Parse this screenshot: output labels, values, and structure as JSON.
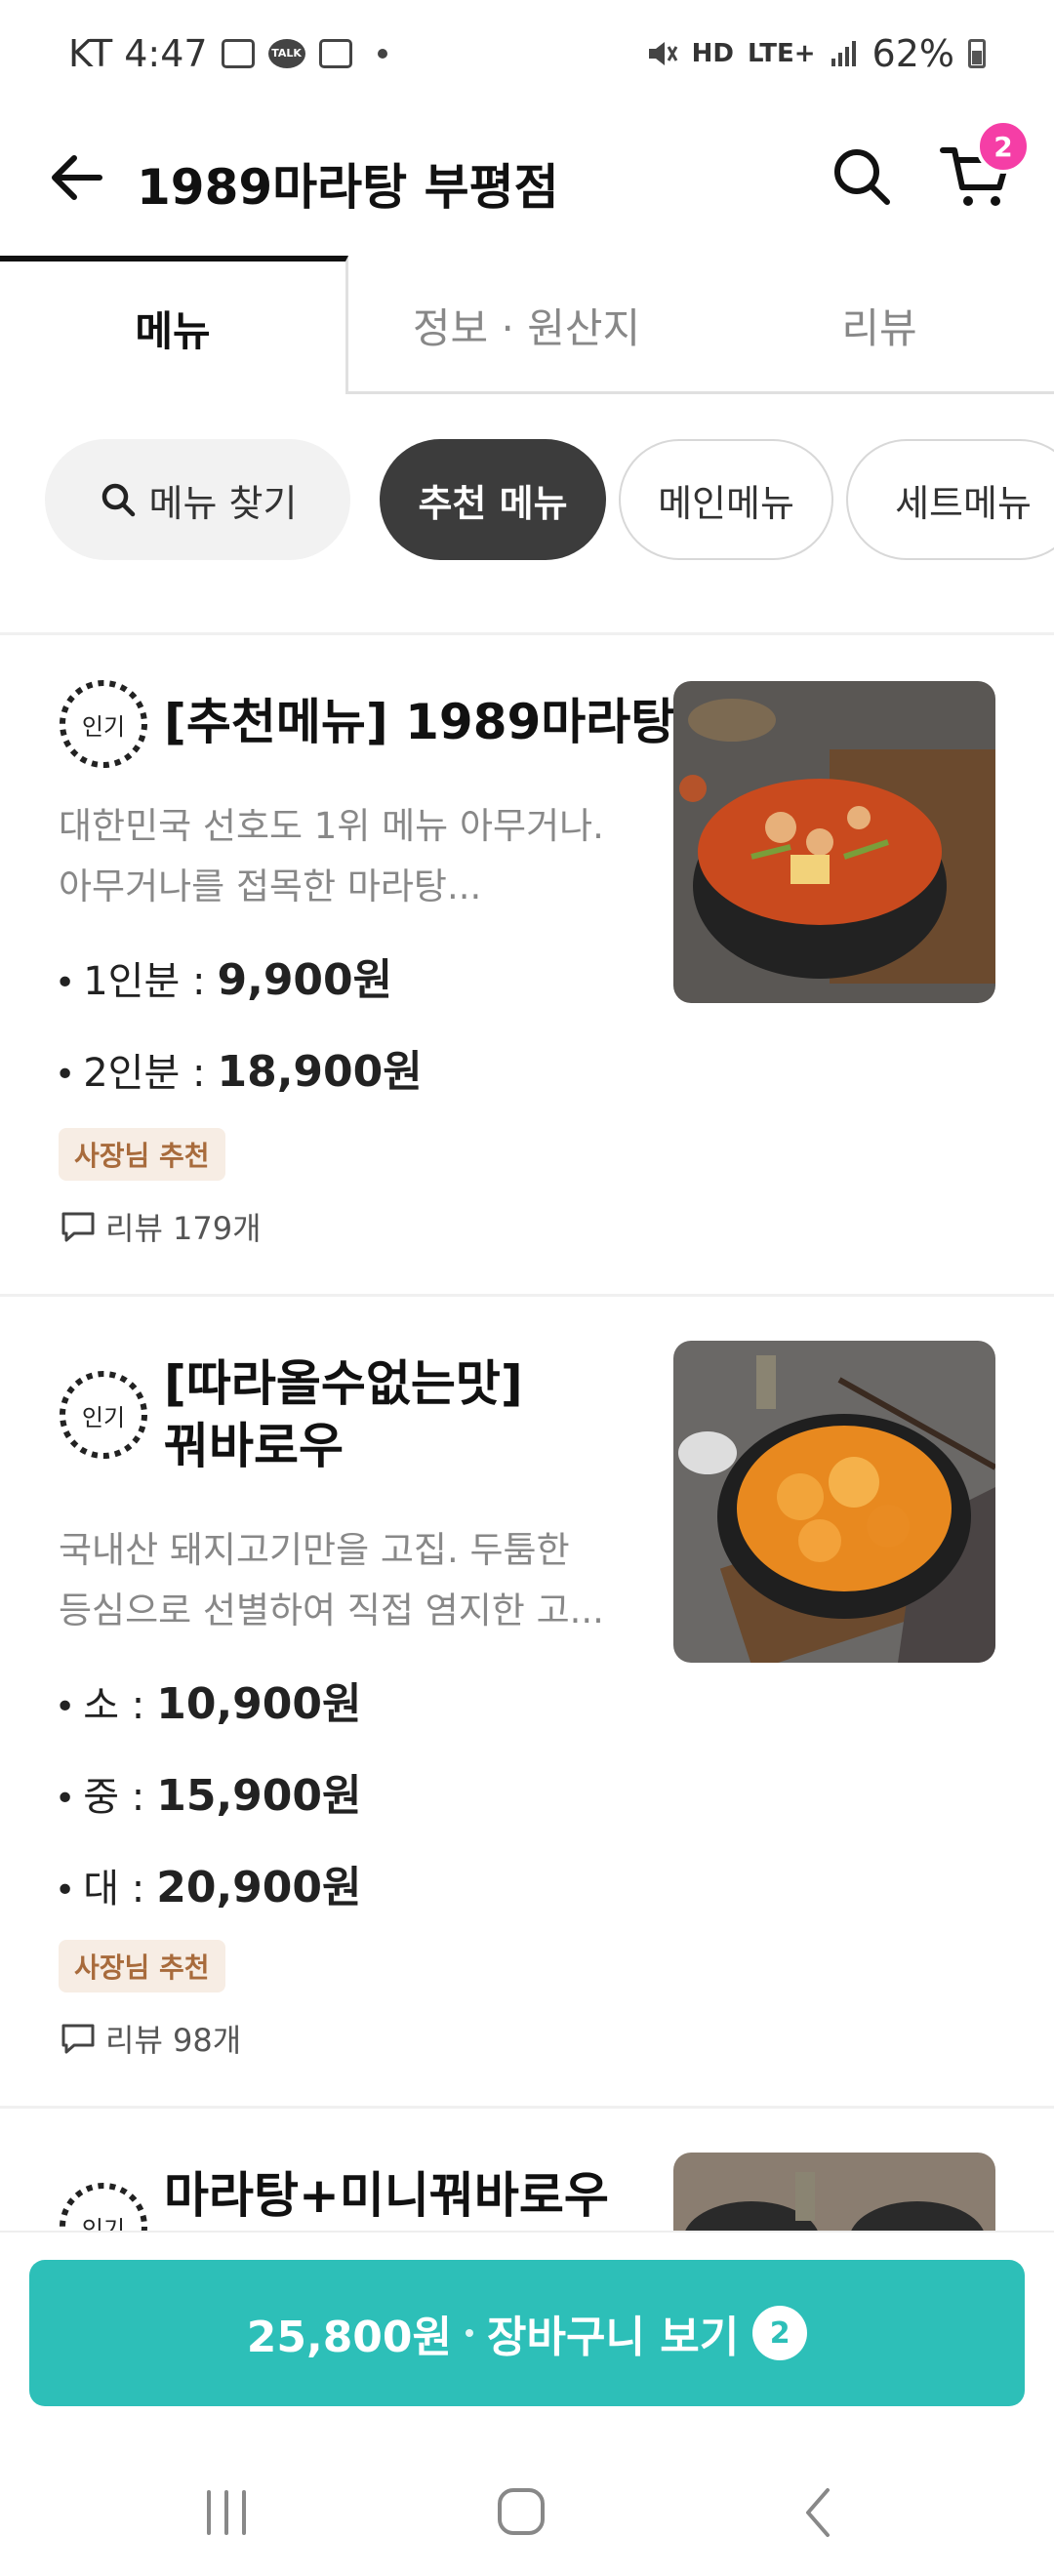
{
  "status_bar": {
    "carrier_time": "KT 4:47",
    "talk": "TALK",
    "hd": "HD",
    "network": "LTE+",
    "battery": "62%"
  },
  "header": {
    "title": "1989마라탕 부평점",
    "cart_count": "2"
  },
  "tabs": [
    {
      "label": "메뉴"
    },
    {
      "label": "정보 · 원산지"
    },
    {
      "label": "리뷰"
    }
  ],
  "filters": {
    "search_label": "메뉴 찾기",
    "chips": [
      {
        "label": "추천 메뉴"
      },
      {
        "label": "메인메뉴"
      },
      {
        "label": "세트메뉴"
      }
    ]
  },
  "menu_items": [
    {
      "badge": "인기",
      "name": "[추천메뉴] 1989마라탕",
      "desc_line1": "대한민국 선호도 1위 메뉴 아무거나.",
      "desc_line2": "아무거나를 접목한 마라탕...",
      "prices": [
        {
          "label": "1인분 :",
          "value": "9,900원"
        },
        {
          "label": "2인분 :",
          "value": "18,900원"
        }
      ],
      "tag": "사장님 추천",
      "reviews": "리뷰 179개"
    },
    {
      "badge": "인기",
      "name_line1": "[따라올수없는맛]",
      "name_line2": "꿔바로우",
      "desc_line1": "국내산 돼지고기만을 고집. 두툼한",
      "desc_line2": "등심으로 선별하여 직접 염지한 고...",
      "prices": [
        {
          "label": "소 :",
          "value": "10,900원"
        },
        {
          "label": "중 :",
          "value": "15,900원"
        },
        {
          "label": "대 :",
          "value": "20,900원"
        }
      ],
      "tag": "사장님 추천",
      "reviews": "리뷰 98개"
    },
    {
      "badge": "인기",
      "name": "마라탕+미니꿔바로우"
    }
  ],
  "cart_button": {
    "total": "25,800원",
    "label": "장바구니 보기",
    "count": "2"
  },
  "colors": {
    "accent": "#2dbfb8",
    "badge": "#f53ea6",
    "owner_tag_bg": "#f7ede4",
    "owner_tag_text": "#a86b3c"
  }
}
